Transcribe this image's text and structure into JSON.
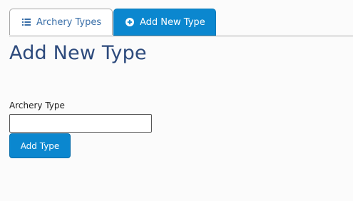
{
  "tabs": {
    "list": {
      "label": "Archery Types",
      "icon": "list-icon"
    },
    "add": {
      "label": "Add New Type",
      "icon": "plus-circle-icon"
    }
  },
  "page": {
    "title": "Add New Type"
  },
  "form": {
    "field_label": "Archery Type",
    "field_value": "",
    "submit_label": "Add Type"
  },
  "colors": {
    "accent": "#0b87cf",
    "title": "#2d4a7c",
    "inactive_tab_text": "#3a6fa8"
  }
}
